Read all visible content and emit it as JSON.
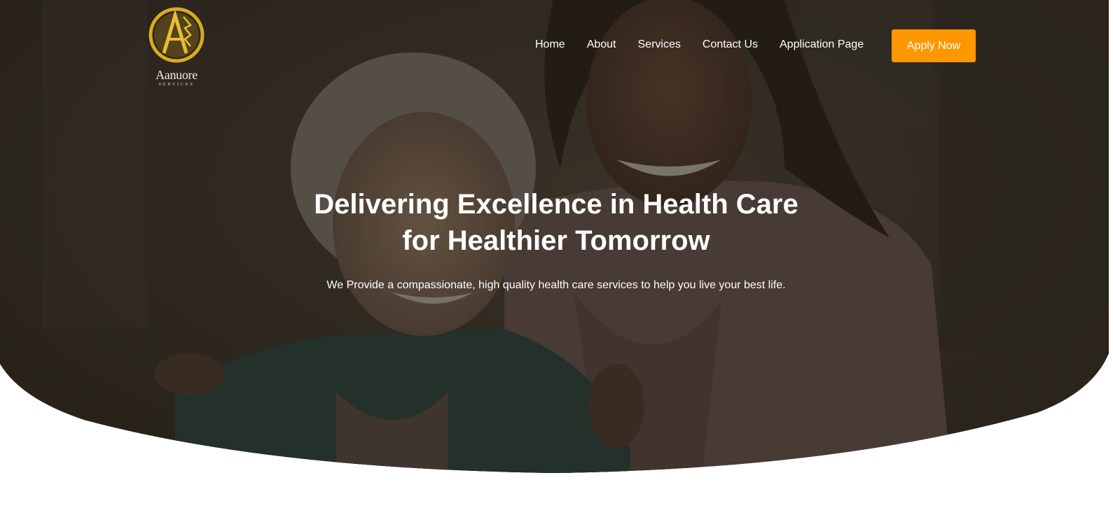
{
  "brand": {
    "name": "Aanuore",
    "tagline": "SERVICES",
    "logo_icon": "golden-monogram-logo",
    "logo_color": "#d9aa1e"
  },
  "nav": {
    "items": [
      {
        "label": "Home"
      },
      {
        "label": "About"
      },
      {
        "label": "Services"
      },
      {
        "label": "Contact Us"
      },
      {
        "label": "Application Page"
      }
    ],
    "cta_label": "Apply Now",
    "cta_color": "#fc9700"
  },
  "hero": {
    "headline_line1": "Delivering Excellence in Health Care",
    "headline_line2": "for Healthier Tomorrow",
    "subtext": "We Provide a compassionate, high quality health care services to help you live your best life.",
    "image": "caregiver-and-elderly-woman-photo",
    "overlay_color": "#2a251d"
  }
}
